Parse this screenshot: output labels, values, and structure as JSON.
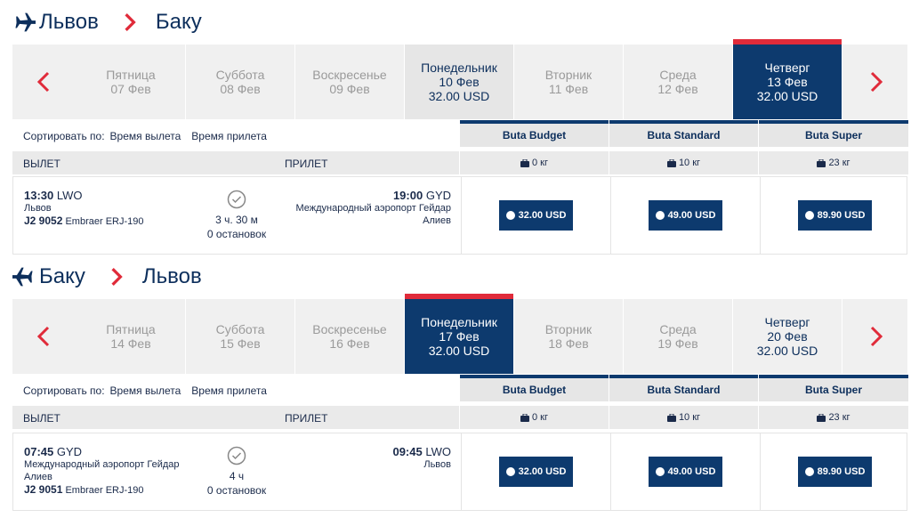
{
  "outbound": {
    "from": "Львов",
    "to": "Баку",
    "days": [
      {
        "name": "Пятница",
        "date": "07 Фев",
        "price": "",
        "state": "muted"
      },
      {
        "name": "Суббота",
        "date": "08 Фев",
        "price": "",
        "state": "muted"
      },
      {
        "name": "Воскресенье",
        "date": "09 Фев",
        "price": "",
        "state": "muted"
      },
      {
        "name": "Понедельник",
        "date": "10 Фев",
        "price": "32.00 USD",
        "state": "avail"
      },
      {
        "name": "Вторник",
        "date": "11 Фев",
        "price": "",
        "state": "muted"
      },
      {
        "name": "Среда",
        "date": "12 Фев",
        "price": "",
        "state": "muted"
      },
      {
        "name": "Четверг",
        "date": "13 Фев",
        "price": "32.00 USD",
        "state": "selected"
      }
    ],
    "flight": {
      "dep_time": "13:30",
      "dep_code": "LWO",
      "dep_airport": "Львов",
      "dep_airport_2": "",
      "flight_no": "J2 9052",
      "aircraft": "Embraer ERJ-190",
      "duration": "3 ч. 30 м",
      "stops": "0 остановок",
      "arr_time": "19:00",
      "arr_code": "GYD",
      "arr_airport": "Международный аэропорт Гейдар",
      "arr_airport_2": "Алиев"
    },
    "fares": [
      "32.00 USD",
      "49.00 USD",
      "89.90 USD"
    ]
  },
  "inbound": {
    "from": "Баку",
    "to": "Львов",
    "days": [
      {
        "name": "Пятница",
        "date": "14 Фев",
        "price": "",
        "state": "muted"
      },
      {
        "name": "Суббота",
        "date": "15 Фев",
        "price": "",
        "state": "muted"
      },
      {
        "name": "Воскресенье",
        "date": "16 Фев",
        "price": "",
        "state": "muted"
      },
      {
        "name": "Понедельник",
        "date": "17 Фев",
        "price": "32.00 USD",
        "state": "selected"
      },
      {
        "name": "Вторник",
        "date": "18 Фев",
        "price": "",
        "state": "muted"
      },
      {
        "name": "Среда",
        "date": "19 Фев",
        "price": "",
        "state": "muted"
      },
      {
        "name": "Четверг",
        "date": "20 Фев",
        "price": "32.00 USD",
        "state": "avail"
      }
    ],
    "flight": {
      "dep_time": "07:45",
      "dep_code": "GYD",
      "dep_airport": "Международный аэропорт Гейдар",
      "dep_airport_2": "Алиев",
      "flight_no": "J2 9051",
      "aircraft": "Embraer ERJ-190",
      "duration": "4 ч",
      "stops": "0 остановок",
      "arr_time": "09:45",
      "arr_code": "LWO",
      "arr_airport": "Львов",
      "arr_airport_2": ""
    },
    "fares": [
      "32.00 USD",
      "49.00 USD",
      "89.90 USD"
    ]
  },
  "labels": {
    "sort_by": "Сортировать по:",
    "sort_dep": "Время вылета",
    "sort_arr": "Время прилета",
    "col_dep": "ВЫЛЕТ",
    "col_arr": "ПРИЛЕТ",
    "fare_names": [
      "Buta Budget",
      "Buta Standard",
      "Buta Super"
    ],
    "bags": [
      "0 кг",
      "10 кг",
      "23 кг"
    ]
  },
  "colors": {
    "navy": "#0d3a6e",
    "accent_red": "#e02b3a",
    "muted_text": "#9a9a9a"
  }
}
